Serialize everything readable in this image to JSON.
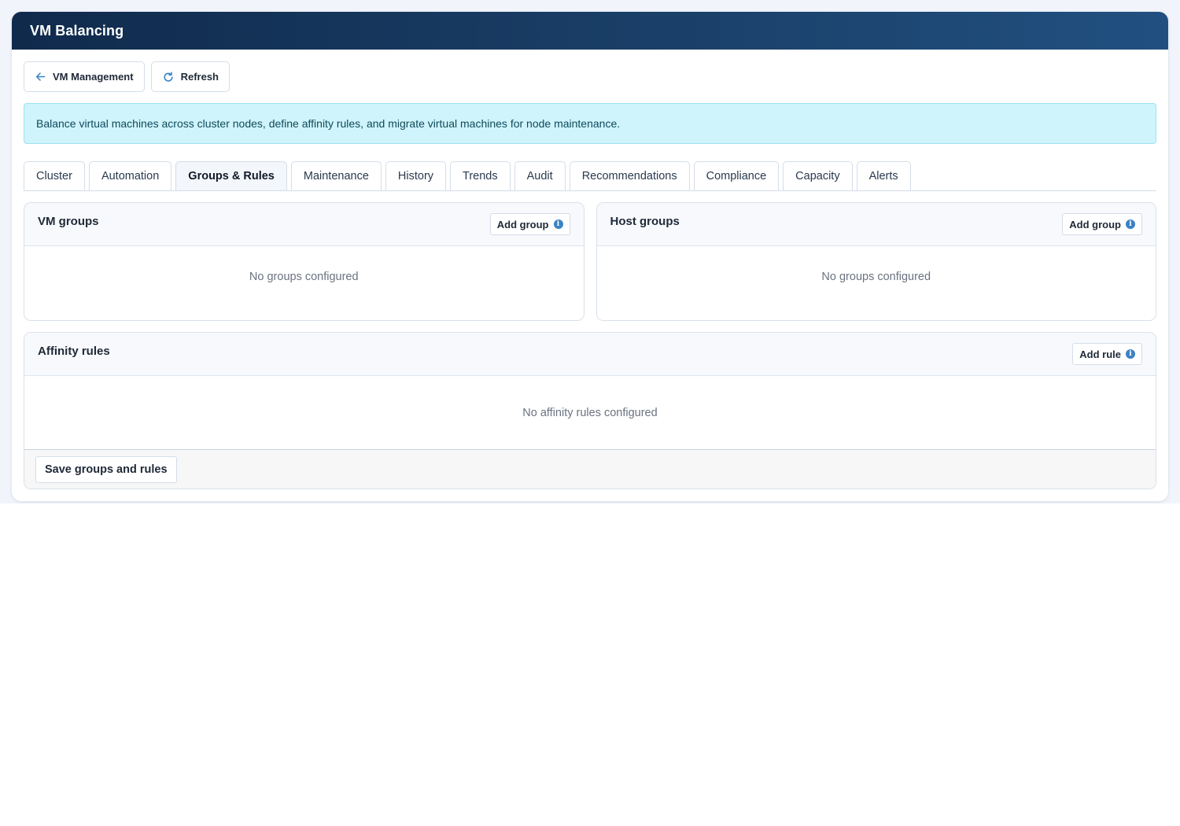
{
  "app": {
    "title": "VM Balancing"
  },
  "toolbar": {
    "back_label": "VM Management",
    "back_icon": "arrow-left-icon",
    "refresh_label": "Refresh",
    "refresh_icon": "refresh-icon",
    "icon_color": "#3b82c4"
  },
  "banner": {
    "text": "Balance virtual machines across cluster nodes, define affinity rules, and migrate virtual machines for node maintenance."
  },
  "tabs": [
    {
      "label": "Cluster",
      "active": false
    },
    {
      "label": "Automation",
      "active": false
    },
    {
      "label": "Groups & Rules",
      "active": true
    },
    {
      "label": "Maintenance",
      "active": false
    },
    {
      "label": "History",
      "active": false
    },
    {
      "label": "Trends",
      "active": false
    },
    {
      "label": "Audit",
      "active": false
    },
    {
      "label": "Recommendations",
      "active": false
    },
    {
      "label": "Compliance",
      "active": false
    },
    {
      "label": "Capacity",
      "active": false
    },
    {
      "label": "Alerts",
      "active": false
    }
  ],
  "vm_groups": {
    "title": "VM groups",
    "add_label": "Add group",
    "empty_text": "No groups configured"
  },
  "host_groups": {
    "title": "Host groups",
    "add_label": "Add group",
    "empty_text": "No groups configured"
  },
  "affinity_rules": {
    "title": "Affinity rules",
    "add_label": "Add rule",
    "empty_text": "No affinity rules configured"
  },
  "footer": {
    "save_label": "Save groups and rules"
  },
  "info_glyph": "i"
}
